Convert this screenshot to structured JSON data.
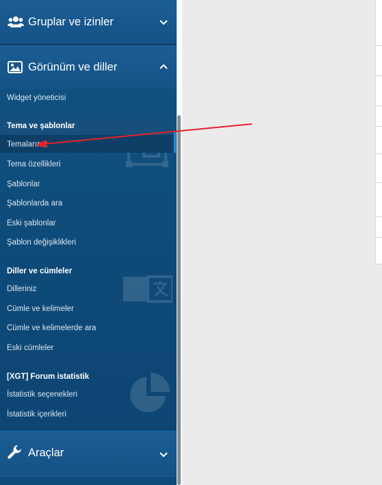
{
  "sidebar": {
    "sections": {
      "groups": {
        "label": "Gruplar ve izinler",
        "icon": "users-icon"
      },
      "appearance": {
        "label": "Görünüm ve diller",
        "icon": "image-icon"
      },
      "tools": {
        "label": "Araçlar",
        "icon": "wrench-icon"
      }
    },
    "widget_manager": "Widget yöneticisi",
    "themes_group": {
      "title": "Tema ve şablonlar",
      "items": [
        "Temalarınız",
        "Tema özellikleri",
        "Şablonlar",
        "Şablonlarda ara",
        "Eski şablonlar",
        "Şablon değişiklikleri"
      ]
    },
    "languages_group": {
      "title": "Diller ve cümleler",
      "items": [
        "Dilleriniz",
        "Cümle ve kelimeler",
        "Cümle ve kelimelerde ara",
        "Eski cümleler"
      ]
    },
    "stats_group": {
      "title": "[XGT] Forum istatistik",
      "items": [
        "İstatistik seçenekleri",
        "İstatistik içerikleri"
      ]
    }
  },
  "colors": {
    "sidebar_bg": "#0f4a7a",
    "header_bg": "#1b5d94",
    "arrow": "#e8202a",
    "content_bg": "#ebebeb"
  }
}
